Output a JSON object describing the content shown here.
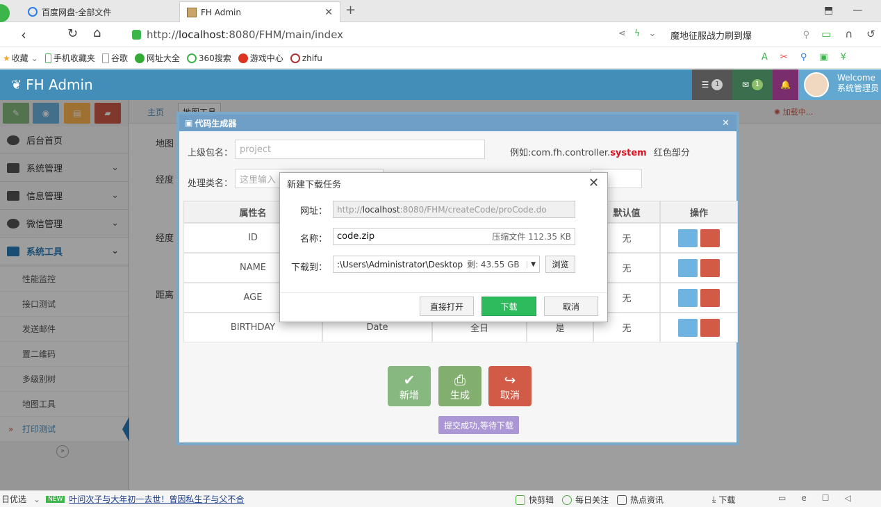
{
  "browser": {
    "tabs": [
      {
        "title": "百度网盘-全部文件",
        "active": false
      },
      {
        "title": "FH Admin",
        "active": true
      }
    ],
    "url_prefix": "http://",
    "url_host": "localhost",
    "url_rest": ":8080/FHM/main/index",
    "search_text": "魔地征服战力刷到爆",
    "bookmarks": [
      "收藏",
      "手机收藏夹",
      "谷歌",
      "网址大全",
      "360搜索",
      "游戏中心",
      "zhifu"
    ]
  },
  "app": {
    "brand": "FH Admin",
    "badges": {
      "tasks": "1",
      "messages": "1"
    },
    "welcome_line1": "Welcome",
    "welcome_line2": "系统管理员",
    "menu": [
      {
        "label": "后台首页"
      },
      {
        "label": "系统管理"
      },
      {
        "label": "信息管理"
      },
      {
        "label": "微信管理"
      },
      {
        "label": "系统工具"
      }
    ],
    "submenu": [
      "性能监控",
      "接口测试",
      "发送邮件",
      "置二维码",
      "多级别树",
      "地图工具",
      "打印测试"
    ],
    "breadcrumb_home": "主页",
    "breadcrumb_tab": "地图工具",
    "loading_text": "加载中...",
    "bg_labels": [
      "地图",
      "经度",
      "经度",
      "距离"
    ]
  },
  "codegen": {
    "title": "代码生成器",
    "package_label": "上级包名：",
    "package_placeholder": "project",
    "example_prefix": "例如:com.fh.controller.",
    "example_highlight": "system",
    "example_suffix": "红色部分",
    "class_label": "处理类名：",
    "class_placeholder": "这里输入",
    "columns": [
      "属性名",
      "默认值",
      "操作"
    ],
    "rows": [
      {
        "name": "ID",
        "default": "无"
      },
      {
        "name": "NAME",
        "default": "无"
      },
      {
        "name": "AGE",
        "default": "无"
      },
      {
        "name": "BIRTHDAY",
        "default": "无",
        "type": "Date",
        "col4": "全日",
        "col5": "是"
      }
    ],
    "btn_add": "新增",
    "btn_generate": "生成",
    "btn_cancel": "取消",
    "tooltip": "提交成功,等待下载"
  },
  "download": {
    "title": "新建下载任务",
    "url_label": "网址：",
    "url_prefix": "http://",
    "url_host": "localhost",
    "url_rest": ":8080/FHM/createCode/proCode.do",
    "name_label": "名称：",
    "name_value": "code.zip",
    "file_info": "压缩文件 112.35 KB",
    "dest_label": "下载到：",
    "dest_value": ":\\Users\\Administrator\\Desktop",
    "free_space": "剩: 43.55 GB",
    "browse": "浏览",
    "open_direct": "直接打开",
    "download": "下载",
    "cancel": "取消"
  },
  "statusbar": {
    "left": "日优选",
    "news_badge": "NEW",
    "news": "叶问次子与大年初一去世！曾因私生子与父不合",
    "items": [
      "快剪辑",
      "每日关注",
      "热点资讯",
      "下载"
    ]
  },
  "colors": {
    "navbar": "#438eb9",
    "green": "#2dbb5d",
    "red": "#d15b47"
  }
}
